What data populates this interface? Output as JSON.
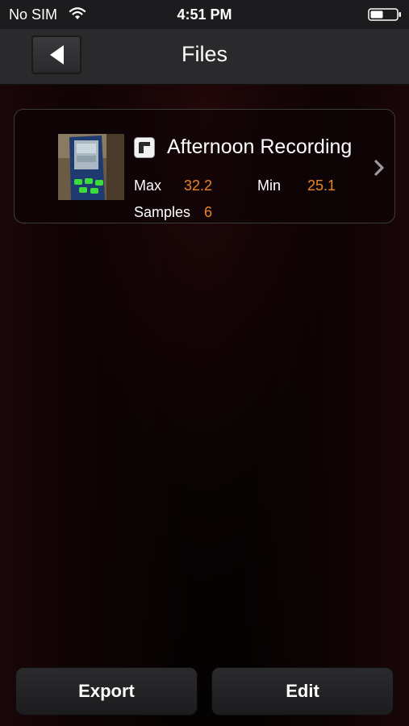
{
  "status_bar": {
    "carrier": "No SIM",
    "time": "4:51 PM"
  },
  "nav": {
    "title": "Files",
    "back_icon": "back-triangle-icon"
  },
  "files": [
    {
      "name": "Afternoon Recording",
      "type_icon": "file-type-icon",
      "max_label": "Max",
      "max_value": "32.2",
      "min_label": "Min",
      "min_value": "25.1",
      "samples_label": "Samples",
      "samples_value": "6"
    }
  ],
  "toolbar": {
    "export_label": "Export",
    "edit_label": "Edit"
  },
  "colors": {
    "accent_value": "#e8852b",
    "nav_bg": "#2a2a2c",
    "background": "#0a0304"
  }
}
